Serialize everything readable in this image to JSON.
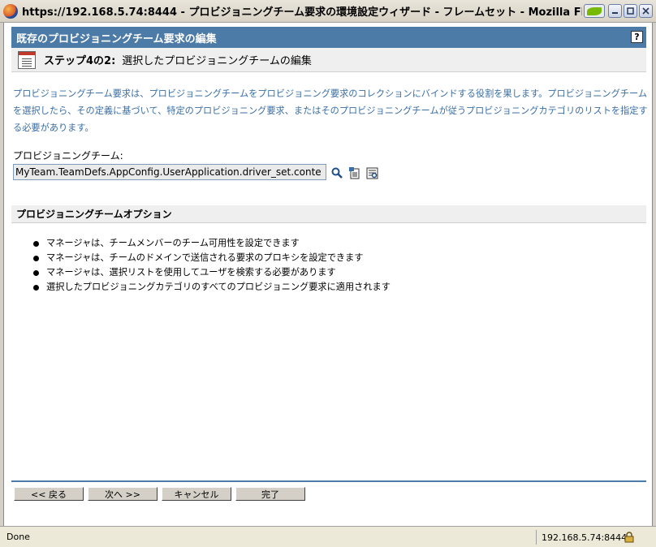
{
  "window": {
    "title": "https://192.168.5.74:8444 - プロビジョニングチーム要求の環境設定ウィザード - フレームセット - Mozilla Firefox"
  },
  "header": {
    "title": "既存のプロビジョニングチーム要求の編集",
    "help": "?"
  },
  "step": {
    "label": "ステップ4の2:",
    "description": "選択したプロビジョニングチームの編集"
  },
  "intro": {
    "text": "プロビジョニングチーム要求は、プロビジョニングチームをプロビジョニング要求のコレクションにバインドする役割を果します。プロビジョニングチームを選択したら、その定義に基づいて、特定のプロビジョニング要求、またはそのプロビジョニングチームが従うプロビジョニングカテゴリのリストを指定する必要があります。"
  },
  "team": {
    "label": "プロビジョニングチーム:",
    "value": "MyTeam.TeamDefs.AppConfig.UserApplication.driver_set.conte"
  },
  "options": {
    "title": "プロビジョニングチームオプション",
    "items": [
      "マネージャは、チームメンバーのチーム可用性を設定できます",
      "マネージャは、チームのドメインで送信される要求のプロキシを設定できます",
      "マネージャは、選択リストを使用してユーザを検索する必要があります",
      "選択したプロビジョニングカテゴリのすべてのプロビジョニング要求に適用されます"
    ]
  },
  "buttons": {
    "back": "<< 戻る",
    "next": "次へ >>",
    "cancel": "キャンセル",
    "finish": "完了"
  },
  "status": {
    "text": "Done",
    "host": "192.168.5.74:8444"
  }
}
